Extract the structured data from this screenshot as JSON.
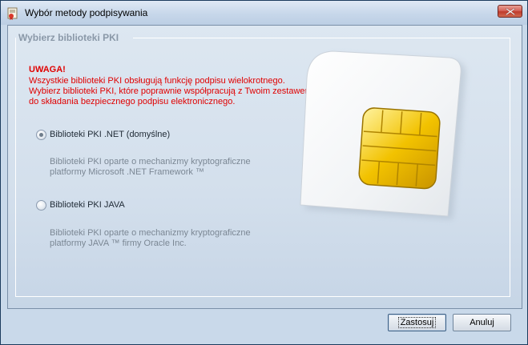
{
  "window": {
    "title": "Wybór metody podpisywania"
  },
  "group": {
    "title": "Wybierz biblioteki PKI"
  },
  "warning": {
    "title": "UWAGA!",
    "lines": [
      "Wszystkie biblioteki PKI obsługują funkcję podpisu wielokrotnego.",
      "Wybierz biblioteki PKI, które poprawnie współpracują z Twoim zestawem",
      "do składania bezpiecznego podpisu elektronicznego."
    ]
  },
  "options": [
    {
      "label": "Biblioteki PKI .NET (domyślne)",
      "selected": true,
      "description": [
        "Biblioteki PKI oparte o mechanizmy kryptograficzne",
        "platformy Microsoft .NET Framework ™"
      ]
    },
    {
      "label": "Biblioteki PKI JAVA",
      "selected": false,
      "description": [
        "Biblioteki PKI oparte o mechanizmy kryptograficzne",
        "platformy JAVA ™ firmy Oracle Inc."
      ]
    }
  ],
  "buttons": {
    "apply": "Zastosuj",
    "cancel": "Anuluj"
  },
  "icons": {
    "app": "certificate-icon",
    "close": "close-icon",
    "illustration": "smart-card-icon"
  },
  "colors": {
    "warning": "#e00000",
    "chip": "#f2c200"
  }
}
